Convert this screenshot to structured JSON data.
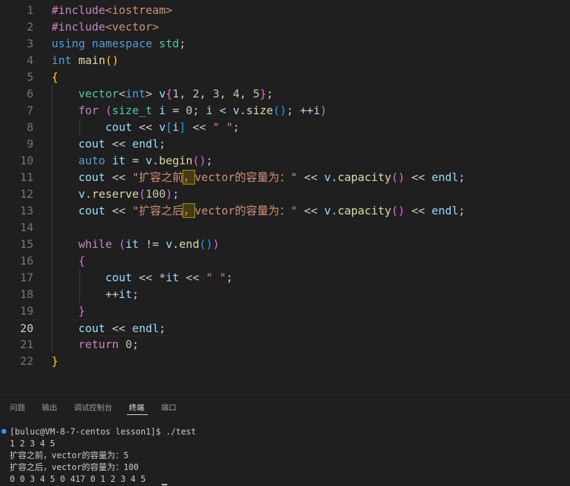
{
  "editor": {
    "current_line": 20,
    "lines": [
      {
        "n": "1",
        "tokens": [
          [
            "t-pre",
            "#include"
          ],
          [
            "t-inc",
            "<iostream>"
          ]
        ]
      },
      {
        "n": "2",
        "tokens": [
          [
            "t-pre",
            "#include"
          ],
          [
            "t-inc",
            "<vector>"
          ]
        ]
      },
      {
        "n": "3",
        "tokens": [
          [
            "t-kw",
            "using"
          ],
          [
            "",
            ""
          ],
          [
            "t-kw",
            " namespace"
          ],
          [
            "t-ty",
            " std"
          ],
          [
            "",
            ";"
          ]
        ]
      },
      {
        "n": "4",
        "tokens": [
          [
            "t-kw",
            "int"
          ],
          [
            "t-fn",
            " main"
          ],
          [
            "t-b1",
            "()"
          ]
        ]
      },
      {
        "n": "5",
        "tokens": [
          [
            "t-b1",
            "{"
          ]
        ]
      },
      {
        "n": "6",
        "tokens": [
          [
            "",
            "    "
          ],
          [
            "t-ty",
            "vector"
          ],
          [
            "",
            "<"
          ],
          [
            "t-kw",
            "int"
          ],
          [
            "",
            "> "
          ],
          [
            "t-var",
            "v"
          ],
          [
            "t-b2",
            "{"
          ],
          [
            "t-num",
            "1"
          ],
          [
            "",
            ", "
          ],
          [
            "t-num",
            "2"
          ],
          [
            "",
            ", "
          ],
          [
            "t-num",
            "3"
          ],
          [
            "",
            ", "
          ],
          [
            "t-num",
            "4"
          ],
          [
            "",
            ", "
          ],
          [
            "t-num",
            "5"
          ],
          [
            "t-b2",
            "}"
          ],
          [
            "",
            ";"
          ]
        ]
      },
      {
        "n": "7",
        "tokens": [
          [
            "",
            "    "
          ],
          [
            "t-ctrl",
            "for"
          ],
          [
            "t-b2",
            " ("
          ],
          [
            "t-ty",
            "size_t"
          ],
          [
            "t-var",
            " i"
          ],
          [
            "",
            " = "
          ],
          [
            "t-num",
            "0"
          ],
          [
            "",
            "; "
          ],
          [
            "t-var",
            "i"
          ],
          [
            "",
            " < "
          ],
          [
            "t-var",
            "v"
          ],
          [
            "",
            "."
          ],
          [
            "t-fn",
            "size"
          ],
          [
            "t-b3",
            "()"
          ],
          [
            "",
            "; ++"
          ],
          [
            "t-var",
            "i"
          ],
          [
            "t-b2",
            ")"
          ]
        ]
      },
      {
        "n": "8",
        "tokens": [
          [
            "",
            "        "
          ],
          [
            "t-var",
            "cout"
          ],
          [
            "",
            " << "
          ],
          [
            "t-var",
            "v"
          ],
          [
            "t-b3",
            "["
          ],
          [
            "t-var",
            "i"
          ],
          [
            "t-b3",
            "]"
          ],
          [
            "",
            " << "
          ],
          [
            "t-str",
            "\" \""
          ],
          [
            "",
            ";"
          ]
        ]
      },
      {
        "n": "9",
        "tokens": [
          [
            "",
            "    "
          ],
          [
            "t-var",
            "cout"
          ],
          [
            "",
            " << "
          ],
          [
            "t-var",
            "endl"
          ],
          [
            "",
            ";"
          ]
        ]
      },
      {
        "n": "10",
        "tokens": [
          [
            "",
            "    "
          ],
          [
            "t-kw",
            "auto"
          ],
          [
            "t-var",
            " it"
          ],
          [
            "",
            " = "
          ],
          [
            "t-var",
            "v"
          ],
          [
            "",
            "."
          ],
          [
            "t-fn",
            "begin"
          ],
          [
            "t-b2",
            "()"
          ],
          [
            "",
            ";"
          ]
        ]
      },
      {
        "n": "11",
        "tokens": [
          [
            "",
            "    "
          ],
          [
            "t-var",
            "cout"
          ],
          [
            "",
            " << "
          ],
          [
            "t-str",
            "\"扩容之前"
          ],
          [
            "t-str warn",
            "，"
          ],
          [
            "t-str",
            "vector的容量为：\""
          ],
          [
            "",
            " << "
          ],
          [
            "t-var",
            "v"
          ],
          [
            "",
            "."
          ],
          [
            "t-fn",
            "capacity"
          ],
          [
            "t-b2",
            "()"
          ],
          [
            "",
            " << "
          ],
          [
            "t-var",
            "endl"
          ],
          [
            "",
            ";"
          ]
        ]
      },
      {
        "n": "12",
        "tokens": [
          [
            "",
            "    "
          ],
          [
            "t-var",
            "v"
          ],
          [
            "",
            "."
          ],
          [
            "t-fn",
            "reserve"
          ],
          [
            "t-b2",
            "("
          ],
          [
            "t-num",
            "100"
          ],
          [
            "t-b2",
            ")"
          ],
          [
            "",
            ";"
          ]
        ]
      },
      {
        "n": "13",
        "tokens": [
          [
            "",
            "    "
          ],
          [
            "t-var",
            "cout"
          ],
          [
            "",
            " << "
          ],
          [
            "t-str",
            "\"扩容之后"
          ],
          [
            "t-str warn",
            "，"
          ],
          [
            "t-str",
            "vector的容量为：\""
          ],
          [
            "",
            " << "
          ],
          [
            "t-var",
            "v"
          ],
          [
            "",
            "."
          ],
          [
            "t-fn",
            "capacity"
          ],
          [
            "t-b2",
            "()"
          ],
          [
            "",
            " << "
          ],
          [
            "t-var",
            "endl"
          ],
          [
            "",
            ";"
          ]
        ]
      },
      {
        "n": "14",
        "tokens": []
      },
      {
        "n": "15",
        "tokens": [
          [
            "",
            "    "
          ],
          [
            "t-ctrl",
            "while"
          ],
          [
            "t-b2",
            " ("
          ],
          [
            "t-var",
            "it"
          ],
          [
            "",
            " != "
          ],
          [
            "t-var",
            "v"
          ],
          [
            "",
            "."
          ],
          [
            "t-fn",
            "end"
          ],
          [
            "t-b3",
            "()"
          ],
          [
            "t-b2",
            ")"
          ]
        ]
      },
      {
        "n": "16",
        "tokens": [
          [
            "",
            "    "
          ],
          [
            "t-b2",
            "{"
          ]
        ]
      },
      {
        "n": "17",
        "tokens": [
          [
            "",
            "        "
          ],
          [
            "t-var",
            "cout"
          ],
          [
            "",
            " << *"
          ],
          [
            "t-var",
            "it"
          ],
          [
            "",
            " << "
          ],
          [
            "t-str",
            "\" \""
          ],
          [
            "",
            ";"
          ]
        ]
      },
      {
        "n": "18",
        "tokens": [
          [
            "",
            "        ++"
          ],
          [
            "t-var",
            "it"
          ],
          [
            "",
            ";"
          ]
        ]
      },
      {
        "n": "19",
        "tokens": [
          [
            "",
            "    "
          ],
          [
            "t-b2",
            "}"
          ]
        ]
      },
      {
        "n": "20",
        "tokens": [
          [
            "",
            "    "
          ],
          [
            "t-var",
            "cout"
          ],
          [
            "",
            " << "
          ],
          [
            "t-var",
            "endl"
          ],
          [
            "",
            ";"
          ]
        ]
      },
      {
        "n": "21",
        "tokens": [
          [
            "",
            "    "
          ],
          [
            "t-ctrl",
            "return"
          ],
          [
            "t-num",
            " 0"
          ],
          [
            "",
            ";"
          ]
        ]
      },
      {
        "n": "22",
        "tokens": [
          [
            "t-b1",
            "}"
          ]
        ]
      }
    ]
  },
  "panel": {
    "tabs": [
      {
        "label": "问题",
        "active": false
      },
      {
        "label": "输出",
        "active": false
      },
      {
        "label": "调试控制台",
        "active": false
      },
      {
        "label": "终端",
        "active": true
      },
      {
        "label": "端口",
        "active": false
      }
    ]
  },
  "terminal": {
    "lines": [
      "[buluc@VM-8-7-centos lesson1]$ ./test",
      "1 2 3 4 5",
      "扩容之前，vector的容量为：5",
      "扩容之后，vector的容量为：100",
      "0 0 3 4 5 0 417 0 1 2 3 4 5"
    ]
  },
  "colors": {
    "background": "#1f1f1f",
    "keyword": "#569cd6",
    "control": "#c586c0",
    "type": "#4ec9b0",
    "function": "#dcdcaa",
    "variable": "#9cdcfe",
    "number": "#b5cea8",
    "string": "#ce9178",
    "bracket_1": "#ffd700",
    "bracket_2": "#da70d6",
    "bracket_3": "#179fff",
    "terminal_dot": "#3794ff"
  }
}
